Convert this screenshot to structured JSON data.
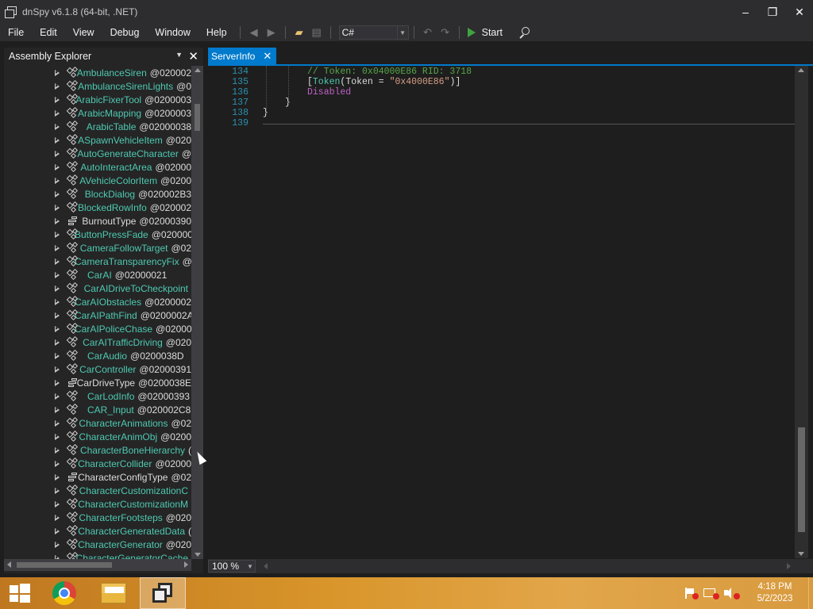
{
  "window": {
    "title": "dnSpy v6.1.8 (64-bit, .NET)",
    "minimize": "–",
    "maximize": "❐",
    "close": "✕"
  },
  "menu": [
    "File",
    "Edit",
    "View",
    "Debug",
    "Window",
    "Help"
  ],
  "toolbar": {
    "language": "C#",
    "start_label": "Start"
  },
  "assembly_explorer": {
    "title": "Assembly Explorer",
    "items": [
      {
        "name": "AmbulanceSiren",
        "token": "@020002",
        "kind": "class"
      },
      {
        "name": "AmbulanceSirenLights",
        "token": "@0",
        "kind": "class"
      },
      {
        "name": "ArabicFixerTool",
        "token": "@0200003",
        "kind": "class"
      },
      {
        "name": "ArabicMapping",
        "token": "@0200003",
        "kind": "class"
      },
      {
        "name": "ArabicTable",
        "token": "@02000038",
        "kind": "class"
      },
      {
        "name": "ASpawnVehicleItem",
        "token": "@020",
        "kind": "class"
      },
      {
        "name": "AutoGenerateCharacter",
        "token": "@",
        "kind": "class"
      },
      {
        "name": "AutoInteractArea",
        "token": "@02000",
        "kind": "class"
      },
      {
        "name": "AVehicleColorItem",
        "token": "@0200",
        "kind": "class"
      },
      {
        "name": "BlockDialog",
        "token": "@020002B3",
        "kind": "class"
      },
      {
        "name": "BlockedRowInfo",
        "token": "@020002",
        "kind": "class"
      },
      {
        "name": "BurnoutType",
        "token": "@02000390",
        "kind": "enum"
      },
      {
        "name": "ButtonPressFade",
        "token": "@0200003",
        "kind": "class"
      },
      {
        "name": "CameraFollowTarget",
        "token": "@02",
        "kind": "class"
      },
      {
        "name": "CameraTransparencyFix",
        "token": "@",
        "kind": "class"
      },
      {
        "name": "CarAI",
        "token": "@02000021",
        "kind": "class"
      },
      {
        "name": "CarAIDriveToCheckpoint",
        "token": "",
        "kind": "class"
      },
      {
        "name": "CarAIObstacles",
        "token": "@0200002",
        "kind": "class"
      },
      {
        "name": "CarAIPathFind",
        "token": "@0200002A",
        "kind": "class"
      },
      {
        "name": "CarAIPoliceChase",
        "token": "@02000",
        "kind": "class"
      },
      {
        "name": "CarAITrafficDriving",
        "token": "@020",
        "kind": "class"
      },
      {
        "name": "CarAudio",
        "token": "@0200038D",
        "kind": "class"
      },
      {
        "name": "CarController",
        "token": "@02000391",
        "kind": "class"
      },
      {
        "name": "CarDriveType",
        "token": "@0200038E",
        "kind": "enum"
      },
      {
        "name": "CarLodInfo",
        "token": "@02000393",
        "kind": "class"
      },
      {
        "name": "CAR_Input",
        "token": "@020002C8",
        "kind": "class"
      },
      {
        "name": "CharacterAnimations",
        "token": "@02",
        "kind": "class"
      },
      {
        "name": "CharacterAnimObj",
        "token": "@0200",
        "kind": "class"
      },
      {
        "name": "CharacterBoneHierarchy",
        "token": "(",
        "kind": "class"
      },
      {
        "name": "CharacterCollider",
        "token": "@02000",
        "kind": "class"
      },
      {
        "name": "CharacterConfigType",
        "token": "@02",
        "kind": "enum"
      },
      {
        "name": "CharacterCustomizationC",
        "token": "",
        "kind": "class"
      },
      {
        "name": "CharacterCustomizationM",
        "token": "",
        "kind": "class"
      },
      {
        "name": "CharacterFootsteps",
        "token": "@020",
        "kind": "class"
      },
      {
        "name": "CharacterGeneratedData",
        "token": "(",
        "kind": "class"
      },
      {
        "name": "CharacterGenerator",
        "token": "@020",
        "kind": "class"
      },
      {
        "name": "CharacterGeneratorCache",
        "token": "",
        "kind": "class"
      }
    ]
  },
  "document": {
    "tab_title": "ServerInfo",
    "lines": [
      {
        "num": "134",
        "indent": 2,
        "tokens": [
          {
            "t": "// Token: 0x04000E86 RID: 3718",
            "c": "comment"
          }
        ]
      },
      {
        "num": "135",
        "indent": 2,
        "tokens": [
          {
            "t": "[",
            "c": "punct"
          },
          {
            "t": "Token",
            "c": "type"
          },
          {
            "t": "(",
            "c": "punct"
          },
          {
            "t": "Token",
            "c": "prop"
          },
          {
            "t": " = ",
            "c": "punct"
          },
          {
            "t": "\"0x4000E86\"",
            "c": "string"
          },
          {
            "t": ")]",
            "c": "punct"
          }
        ]
      },
      {
        "num": "136",
        "indent": 2,
        "tokens": [
          {
            "t": "Disabled",
            "c": "disabled"
          }
        ]
      },
      {
        "num": "137",
        "indent": 1,
        "tokens": [
          {
            "t": "}",
            "c": "punct"
          }
        ]
      },
      {
        "num": "138",
        "indent": 0,
        "tokens": [
          {
            "t": "}",
            "c": "punct"
          }
        ]
      },
      {
        "num": "139",
        "indent": 0,
        "tokens": []
      }
    ]
  },
  "statusbar": {
    "zoom": "100 %"
  },
  "taskbar": {
    "time": "4:18 PM",
    "date": "5/2/2023"
  }
}
